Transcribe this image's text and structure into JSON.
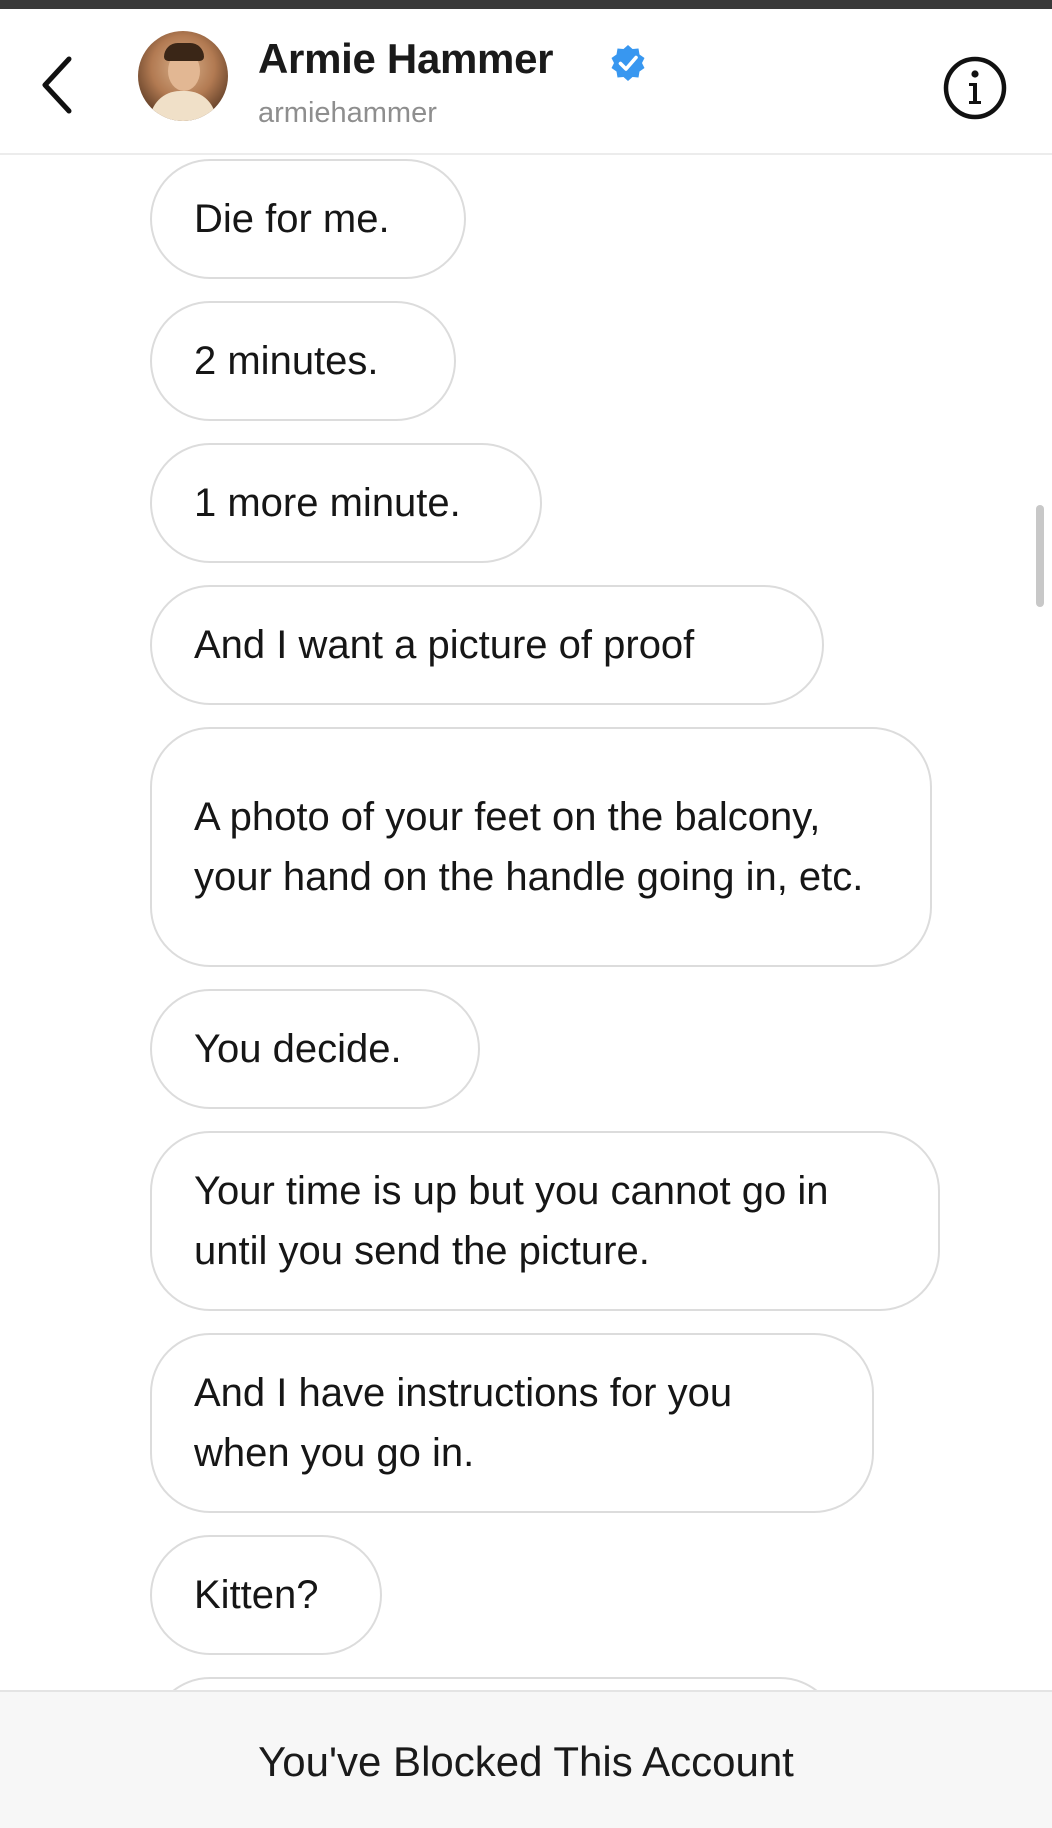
{
  "header": {
    "back_icon": "chevron-left-icon",
    "contact_name": "Armie Hammer",
    "verified_icon": "verified-badge-icon",
    "verified_color": "#3897f0",
    "handle": "armiehammer",
    "info_icon": "info-icon"
  },
  "messages": [
    {
      "text": "Die for me."
    },
    {
      "text": "2 minutes."
    },
    {
      "text": "1 more minute."
    },
    {
      "text": "And I want a picture of proof"
    },
    {
      "text": "A photo of your feet on the balcony, your hand on the handle going in, etc."
    },
    {
      "text": "You decide."
    },
    {
      "text": "Your time is up but you cannot go in until you send the picture."
    },
    {
      "text": "And I have instructions for you when you go in."
    },
    {
      "text": "Kitten?"
    }
  ],
  "footer": {
    "title": "You've Blocked This Account",
    "subtitle": ""
  }
}
